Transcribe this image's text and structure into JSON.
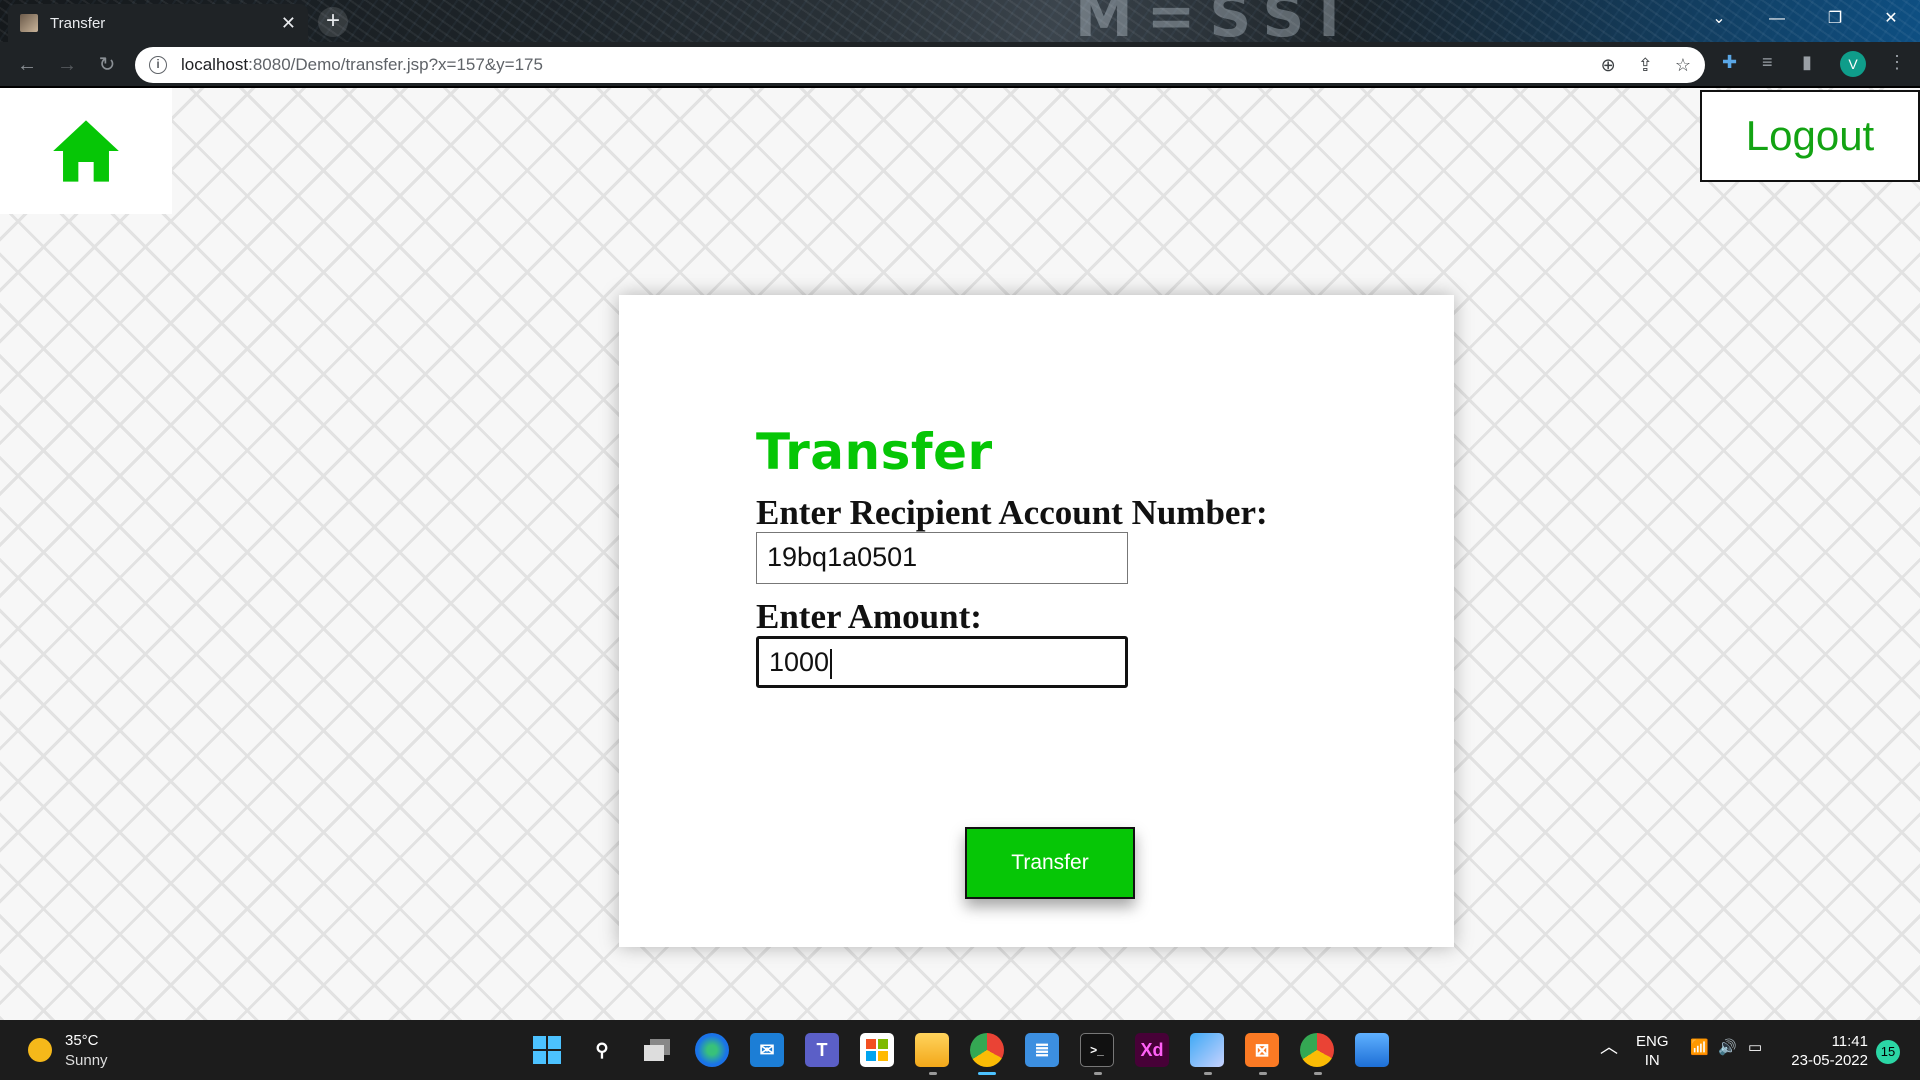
{
  "browser": {
    "tab_title": "Transfer",
    "tab_close": "✕",
    "new_tab": "+",
    "wallpaper_text": "M=SSI",
    "url_host": "localhost",
    "url_rest": ":8080/Demo/transfer.jsp?x=157&y=175",
    "profile_initial": "V"
  },
  "page": {
    "logout_label": "Logout",
    "heading": "Transfer",
    "account_label": "Enter Recipient Account Number:",
    "account_value": "19bq1a0501",
    "amount_label": "Enter Amount:",
    "amount_value": "1000",
    "submit_label": "Transfer",
    "accent_color": "#06c606"
  },
  "taskbar": {
    "temperature": "35°C",
    "weather": "Sunny",
    "lang_line1": "ENG",
    "lang_line2": "IN",
    "time": "11:41",
    "date": "23-05-2022",
    "notifications": "15",
    "apps": [
      "start",
      "search",
      "task-view",
      "edge",
      "mail",
      "teams",
      "store",
      "file-explorer",
      "chrome",
      "notepad",
      "terminal",
      "adobe-xd",
      "app-cube",
      "xampp",
      "chrome-profile",
      "photos"
    ]
  }
}
